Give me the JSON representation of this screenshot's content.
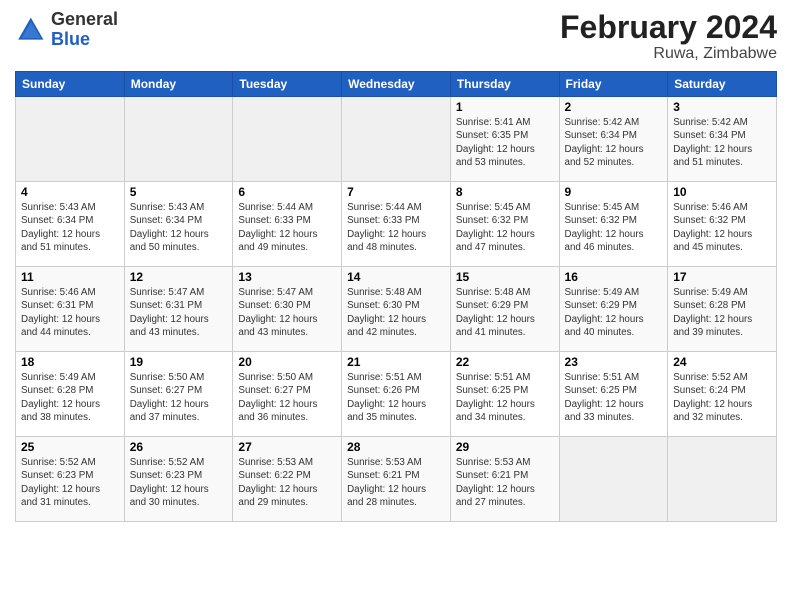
{
  "header": {
    "logo": {
      "line1": "General",
      "line2": "Blue"
    },
    "title": "February 2024",
    "subtitle": "Ruwa, Zimbabwe"
  },
  "days_of_week": [
    "Sunday",
    "Monday",
    "Tuesday",
    "Wednesday",
    "Thursday",
    "Friday",
    "Saturday"
  ],
  "weeks": [
    [
      {
        "day": "",
        "content": ""
      },
      {
        "day": "",
        "content": ""
      },
      {
        "day": "",
        "content": ""
      },
      {
        "day": "",
        "content": ""
      },
      {
        "day": "1",
        "content": "Sunrise: 5:41 AM\nSunset: 6:35 PM\nDaylight: 12 hours\nand 53 minutes."
      },
      {
        "day": "2",
        "content": "Sunrise: 5:42 AM\nSunset: 6:34 PM\nDaylight: 12 hours\nand 52 minutes."
      },
      {
        "day": "3",
        "content": "Sunrise: 5:42 AM\nSunset: 6:34 PM\nDaylight: 12 hours\nand 51 minutes."
      }
    ],
    [
      {
        "day": "4",
        "content": "Sunrise: 5:43 AM\nSunset: 6:34 PM\nDaylight: 12 hours\nand 51 minutes."
      },
      {
        "day": "5",
        "content": "Sunrise: 5:43 AM\nSunset: 6:34 PM\nDaylight: 12 hours\nand 50 minutes."
      },
      {
        "day": "6",
        "content": "Sunrise: 5:44 AM\nSunset: 6:33 PM\nDaylight: 12 hours\nand 49 minutes."
      },
      {
        "day": "7",
        "content": "Sunrise: 5:44 AM\nSunset: 6:33 PM\nDaylight: 12 hours\nand 48 minutes."
      },
      {
        "day": "8",
        "content": "Sunrise: 5:45 AM\nSunset: 6:32 PM\nDaylight: 12 hours\nand 47 minutes."
      },
      {
        "day": "9",
        "content": "Sunrise: 5:45 AM\nSunset: 6:32 PM\nDaylight: 12 hours\nand 46 minutes."
      },
      {
        "day": "10",
        "content": "Sunrise: 5:46 AM\nSunset: 6:32 PM\nDaylight: 12 hours\nand 45 minutes."
      }
    ],
    [
      {
        "day": "11",
        "content": "Sunrise: 5:46 AM\nSunset: 6:31 PM\nDaylight: 12 hours\nand 44 minutes."
      },
      {
        "day": "12",
        "content": "Sunrise: 5:47 AM\nSunset: 6:31 PM\nDaylight: 12 hours\nand 43 minutes."
      },
      {
        "day": "13",
        "content": "Sunrise: 5:47 AM\nSunset: 6:30 PM\nDaylight: 12 hours\nand 43 minutes."
      },
      {
        "day": "14",
        "content": "Sunrise: 5:48 AM\nSunset: 6:30 PM\nDaylight: 12 hours\nand 42 minutes."
      },
      {
        "day": "15",
        "content": "Sunrise: 5:48 AM\nSunset: 6:29 PM\nDaylight: 12 hours\nand 41 minutes."
      },
      {
        "day": "16",
        "content": "Sunrise: 5:49 AM\nSunset: 6:29 PM\nDaylight: 12 hours\nand 40 minutes."
      },
      {
        "day": "17",
        "content": "Sunrise: 5:49 AM\nSunset: 6:28 PM\nDaylight: 12 hours\nand 39 minutes."
      }
    ],
    [
      {
        "day": "18",
        "content": "Sunrise: 5:49 AM\nSunset: 6:28 PM\nDaylight: 12 hours\nand 38 minutes."
      },
      {
        "day": "19",
        "content": "Sunrise: 5:50 AM\nSunset: 6:27 PM\nDaylight: 12 hours\nand 37 minutes."
      },
      {
        "day": "20",
        "content": "Sunrise: 5:50 AM\nSunset: 6:27 PM\nDaylight: 12 hours\nand 36 minutes."
      },
      {
        "day": "21",
        "content": "Sunrise: 5:51 AM\nSunset: 6:26 PM\nDaylight: 12 hours\nand 35 minutes."
      },
      {
        "day": "22",
        "content": "Sunrise: 5:51 AM\nSunset: 6:25 PM\nDaylight: 12 hours\nand 34 minutes."
      },
      {
        "day": "23",
        "content": "Sunrise: 5:51 AM\nSunset: 6:25 PM\nDaylight: 12 hours\nand 33 minutes."
      },
      {
        "day": "24",
        "content": "Sunrise: 5:52 AM\nSunset: 6:24 PM\nDaylight: 12 hours\nand 32 minutes."
      }
    ],
    [
      {
        "day": "25",
        "content": "Sunrise: 5:52 AM\nSunset: 6:23 PM\nDaylight: 12 hours\nand 31 minutes."
      },
      {
        "day": "26",
        "content": "Sunrise: 5:52 AM\nSunset: 6:23 PM\nDaylight: 12 hours\nand 30 minutes."
      },
      {
        "day": "27",
        "content": "Sunrise: 5:53 AM\nSunset: 6:22 PM\nDaylight: 12 hours\nand 29 minutes."
      },
      {
        "day": "28",
        "content": "Sunrise: 5:53 AM\nSunset: 6:21 PM\nDaylight: 12 hours\nand 28 minutes."
      },
      {
        "day": "29",
        "content": "Sunrise: 5:53 AM\nSunset: 6:21 PM\nDaylight: 12 hours\nand 27 minutes."
      },
      {
        "day": "",
        "content": ""
      },
      {
        "day": "",
        "content": ""
      }
    ]
  ]
}
